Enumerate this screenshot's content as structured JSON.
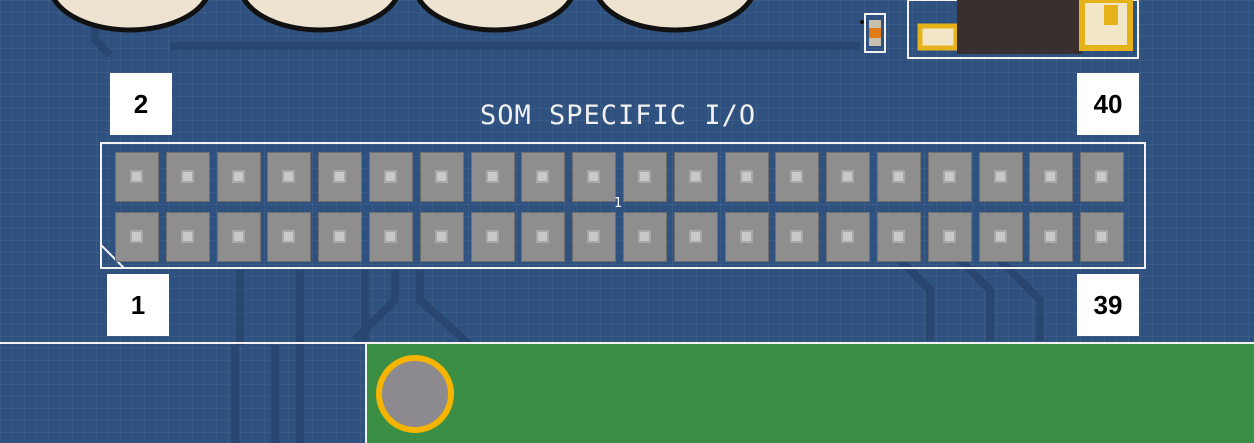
{
  "board": {
    "title": "SOM SPECIFIC I/O",
    "center_marker": "1",
    "colors": {
      "substrate": "#2f5180",
      "silkscreen": "#f2f2f2",
      "pad": "#8e8e8e",
      "green_region": "#3a8f45",
      "gold_ring": "#f4b400",
      "mount_hole": "#8c8a8e"
    }
  },
  "pin_labels": {
    "top_left": "2",
    "top_right": "40",
    "bottom_left": "1",
    "bottom_right": "39"
  },
  "header": {
    "columns": 20,
    "rows": 2
  }
}
